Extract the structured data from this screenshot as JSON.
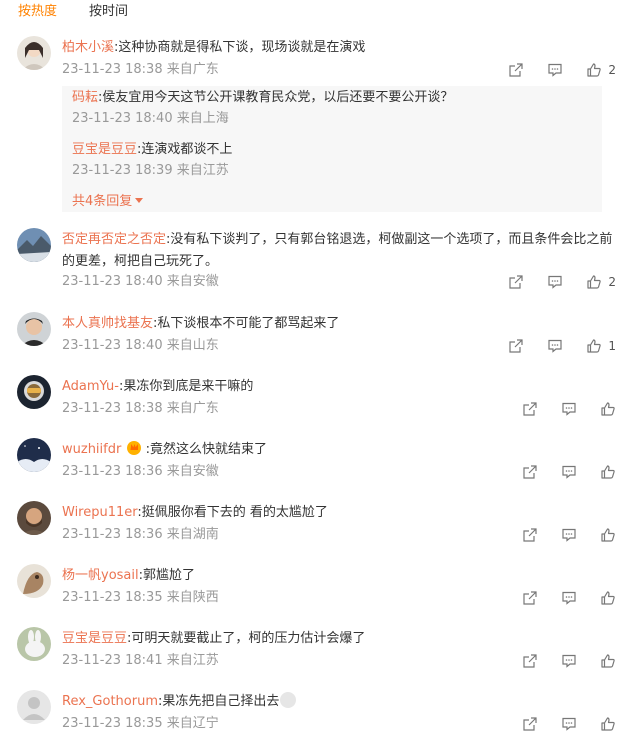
{
  "tabs": {
    "hot": "按热度",
    "time": "按时间"
  },
  "comments": [
    {
      "name": "柏木小溪",
      "text": "这种协商就是得私下谈，现场谈就是在演戏",
      "time": "23-11-23 18:38",
      "location": "来自广东",
      "likes": "2",
      "replies": [
        {
          "name": "码耘",
          "text": "侯友宜用今天这节公开课教育民众党，以后还要不要公开谈？",
          "time": "23-11-23 18:40",
          "location": "来自上海"
        },
        {
          "name": "豆宝是豆豆",
          "text": "连演戏都谈不上",
          "time": "23-11-23 18:39",
          "location": "来自江苏"
        }
      ],
      "more_replies": "共4条回复"
    },
    {
      "name": "否定再否定之否定",
      "text": "没有私下谈判了，只有郭台铭退选，柯做副这一个选项了，而且条件会比之前",
      "text2": "的更差，柯把自己玩死了。",
      "time": "23-11-23 18:40",
      "location": "来自安徽",
      "likes": "2"
    },
    {
      "name": "本人真帅找基友",
      "text": "私下谈根本不可能了都骂起来了",
      "time": "23-11-23 18:40",
      "location": "来自山东",
      "likes": "1"
    },
    {
      "name": "AdamYu-",
      "text": "果冻你到底是来干嘛的",
      "time": "23-11-23 18:38",
      "location": "来自广东"
    },
    {
      "name": "wuzhiifdr",
      "text": "竟然这么快就结束了",
      "time": "23-11-23 18:36",
      "location": "来自安徽"
    },
    {
      "name": "Wirepu11er",
      "text": "挺佩服你看下去的 看的太尴尬了",
      "time": "23-11-23 18:36",
      "location": "来自湖南"
    },
    {
      "name": "杨一帆yosail",
      "text": "郭尴尬了",
      "time": "23-11-23 18:35",
      "location": "来自陕西"
    },
    {
      "name": "豆宝是豆豆",
      "text": "可明天就要截止了，柯的压力估计会爆了",
      "time": "23-11-23 18:41",
      "location": "来自江苏"
    },
    {
      "name": "Rex_Gothorum",
      "text": "果冻先把自己择出去",
      "time": "23-11-23 18:35",
      "location": "来自辽宁"
    }
  ],
  "icons": {
    "share": "share-icon",
    "comment": "comment-icon",
    "like": "like-icon"
  },
  "colors": {
    "accent": "#ff8200",
    "name": "#eb7350",
    "meta": "#999999"
  }
}
